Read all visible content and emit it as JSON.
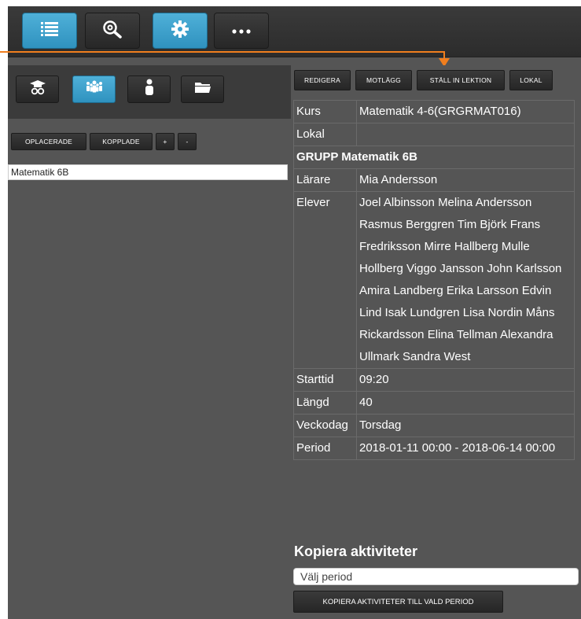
{
  "toolbar": {
    "buttons": [
      {
        "icon": "list-icon",
        "active": true
      },
      {
        "icon": "zoom-search-icon",
        "active": false
      },
      {
        "icon": "gear-icon",
        "active": true
      },
      {
        "icon": "more-dots-icon",
        "active": false
      }
    ]
  },
  "left_panel": {
    "tabs": [
      {
        "icon": "teacher-icon",
        "active": false
      },
      {
        "icon": "group-icon",
        "active": true
      },
      {
        "icon": "person-icon",
        "active": false
      },
      {
        "icon": "folder-icon",
        "active": false
      }
    ],
    "filter_buttons": {
      "unplaced": "OPLACERADE",
      "linked": "KOPPLADE",
      "add": "+",
      "remove": "-"
    },
    "list_items": [
      "Matematik 6B"
    ]
  },
  "right_panel": {
    "actions": {
      "edit": "REDIGERA",
      "counter": "MOTLÄGG",
      "set_in_lesson": "STÄLL IN LEKTION",
      "room": "LOKAL"
    },
    "info": {
      "course_label": "Kurs",
      "course_value": "Matematik 4-6(GRGRMAT016)",
      "room_label": "Lokal",
      "room_value": "",
      "group_header": "GRUPP Matematik 6B",
      "teacher_label": "Lärare",
      "teacher_value": "Mia Andersson",
      "students_label": "Elever",
      "students_value": "Joel Albinsson Melina Andersson Rasmus Berggren Tim Björk Frans Fredriksson Mirre Hallberg Mulle Hollberg Viggo Jansson John Karlsson Amira Landberg Erika Larsson Edvin Lind Isak Lundgren Lisa Nordin Måns Rickardsson Elina Tellman Alexandra Ullmark Sandra West",
      "start_label": "Starttid",
      "start_value": "09:20",
      "length_label": "Längd",
      "length_value": "40",
      "weekday_label": "Veckodag",
      "weekday_value": "Torsdag",
      "period_label": "Period",
      "period_value": "2018-01-11 00:00 - 2018-06-14 00:00"
    },
    "copy": {
      "title": "Kopiera aktiviteter",
      "period_placeholder": "Välj period",
      "copy_button": "KOPIERA AKTIVITETER TILL VALD PERIOD"
    }
  },
  "colors": {
    "accent_blue": "#3aa1cf",
    "arrow_orange": "#f07e1e",
    "panel_gray": "#555555"
  }
}
